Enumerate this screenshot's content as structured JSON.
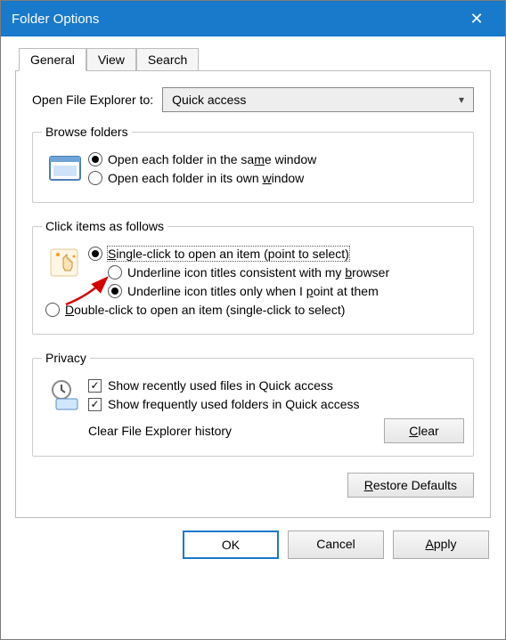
{
  "window": {
    "title": "Folder Options"
  },
  "tabs": {
    "general": "General",
    "view": "View",
    "search": "Search"
  },
  "open_to": {
    "label": "Open File Explorer to:",
    "value": "Quick access"
  },
  "browse": {
    "legend": "Browse folders",
    "r1_pre": "Open each folder in the sa",
    "r1_u": "m",
    "r1_post": "e window",
    "r2_pre": "Open each folder in its own ",
    "r2_u": "w",
    "r2_post": "indow"
  },
  "click": {
    "legend": "Click items as follows",
    "s_pre": "",
    "s_u": "S",
    "s_post": "ingle-click to open an item (point to select)",
    "sub1_pre": "Underline icon titles consistent with my ",
    "sub1_u": "b",
    "sub1_post": "rowser",
    "sub2_pre": "Underline icon titles only when I ",
    "sub2_u": "p",
    "sub2_post": "oint at them",
    "d_pre": "",
    "d_u": "D",
    "d_post": "ouble-click to open an item (single-click to select)"
  },
  "privacy": {
    "legend": "Privacy",
    "c1": "Show recently used files in Quick access",
    "c2": "Show frequently used folders in Quick access",
    "clear_label": "Clear File Explorer history",
    "clear_u": "C",
    "clear_post": "lear"
  },
  "restore_u": "R",
  "restore_post": "estore Defaults",
  "footer": {
    "ok": "OK",
    "cancel": "Cancel",
    "apply_u": "A",
    "apply_post": "pply"
  }
}
